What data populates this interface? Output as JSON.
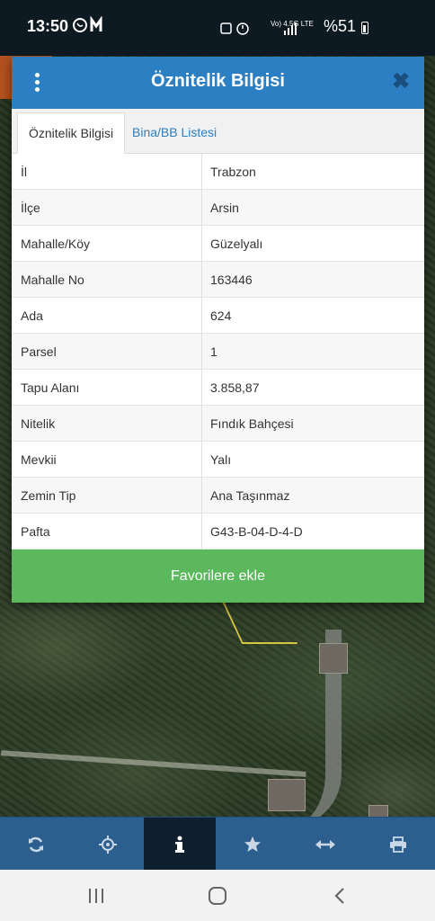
{
  "status_bar": {
    "time": "13:50",
    "network": "Vo) 4.5G LTE",
    "battery": "%51"
  },
  "dialog": {
    "title": "Öznitelik Bilgisi",
    "tabs": [
      {
        "label": "Öznitelik Bilgisi",
        "active": true
      },
      {
        "label": "Bina/BB Listesi",
        "active": false
      }
    ],
    "rows": [
      {
        "key": "İl",
        "value": "Trabzon"
      },
      {
        "key": "İlçe",
        "value": "Arsin"
      },
      {
        "key": "Mahalle/Köy",
        "value": "Güzelyalı"
      },
      {
        "key": "Mahalle No",
        "value": "163446"
      },
      {
        "key": "Ada",
        "value": "624"
      },
      {
        "key": "Parsel",
        "value": "1"
      },
      {
        "key": "Tapu Alanı",
        "value": "3.858,87"
      },
      {
        "key": "Nitelik",
        "value": "Fındık Bahçesi"
      },
      {
        "key": "Mevkii",
        "value": "Yalı"
      },
      {
        "key": "Zemin Tip",
        "value": "Ana Taşınmaz"
      },
      {
        "key": "Pafta",
        "value": "G43-B-04-D-4-D"
      }
    ],
    "favorite_button": "Favorilere ekle"
  },
  "toolbar": {
    "items": [
      {
        "icon": "refresh-icon",
        "active": false
      },
      {
        "icon": "locate-icon",
        "active": false
      },
      {
        "icon": "info-icon",
        "active": true
      },
      {
        "icon": "star-icon",
        "active": false
      },
      {
        "icon": "measure-icon",
        "active": false
      },
      {
        "icon": "print-icon",
        "active": false
      }
    ]
  },
  "colors": {
    "header": "#2c7fc2",
    "favorite_button": "#5cb85c",
    "toolbar": "#2c5f8d",
    "toolbar_active": "#0f1f2e"
  }
}
